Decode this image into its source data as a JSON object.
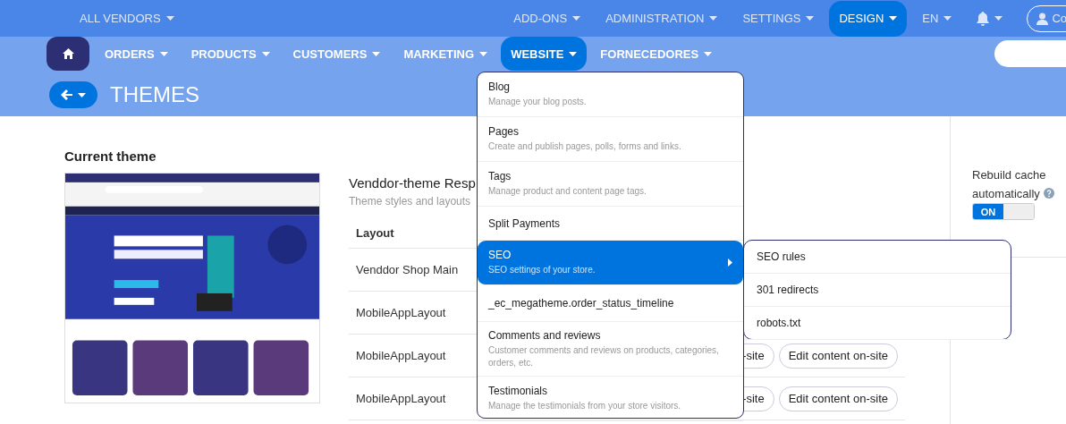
{
  "top_bar": {
    "vendor_menu": "ALL VENDORS",
    "menus": [
      {
        "label": "ADD-ONS",
        "selected": false
      },
      {
        "label": "ADMINISTRATION",
        "selected": false
      },
      {
        "label": "SETTINGS",
        "selected": false
      },
      {
        "label": "DESIGN",
        "selected": true
      }
    ],
    "language": "EN",
    "user": "Co"
  },
  "nav": {
    "items": [
      {
        "label": "ORDERS",
        "selected": false
      },
      {
        "label": "PRODUCTS",
        "selected": false
      },
      {
        "label": "CUSTOMERS",
        "selected": false
      },
      {
        "label": "MARKETING",
        "selected": false
      },
      {
        "label": "WEBSITE",
        "selected": true
      },
      {
        "label": "FORNECEDORES",
        "selected": false
      }
    ]
  },
  "page_title": "THEMES",
  "current_theme": {
    "title": "Current theme"
  },
  "theme": {
    "name": "Venddor-theme Resp",
    "description": "Theme styles and layouts",
    "table": {
      "columns": [
        "Layout"
      ],
      "rows": [
        {
          "layout": "Venddor Shop Main",
          "actions": []
        },
        {
          "layout": "MobileAppLayout",
          "actions": []
        },
        {
          "layout": "MobileAppLayout",
          "actions": [
            "-site",
            "Edit content on-site"
          ]
        },
        {
          "layout": "MobileAppLayout",
          "actions": [
            "-site",
            "Edit content on-site"
          ]
        }
      ]
    }
  },
  "website_menu": {
    "items": [
      {
        "title": "Blog",
        "description": "Manage your blog posts.",
        "selected": false,
        "submenu": false
      },
      {
        "title": "Pages",
        "description": "Create and publish pages, polls, forms and links.",
        "selected": false,
        "submenu": false
      },
      {
        "title": "Tags",
        "description": "Manage product and content page tags.",
        "selected": false,
        "submenu": false
      },
      {
        "title": "Split Payments",
        "selected": false,
        "submenu": false
      },
      {
        "title": "SEO",
        "description": "SEO settings of your store.",
        "selected": true,
        "submenu": true
      },
      {
        "title": "_ec_megatheme.order_status_timeline",
        "selected": false,
        "submenu": false
      },
      {
        "title": "Comments and reviews",
        "description": "Customer comments and reviews on products, categories, orders, etc.",
        "selected": false,
        "submenu": false
      },
      {
        "title": "Testimonials",
        "description": "Manage the testimonials from your store visitors.",
        "selected": false,
        "submenu": false
      }
    ]
  },
  "seo_submenu": {
    "items": [
      "SEO rules",
      "301 redirects",
      "robots.txt"
    ]
  },
  "sidebar": {
    "label": "Rebuild cache automatically",
    "toggle": {
      "on": true,
      "label": "ON"
    }
  }
}
